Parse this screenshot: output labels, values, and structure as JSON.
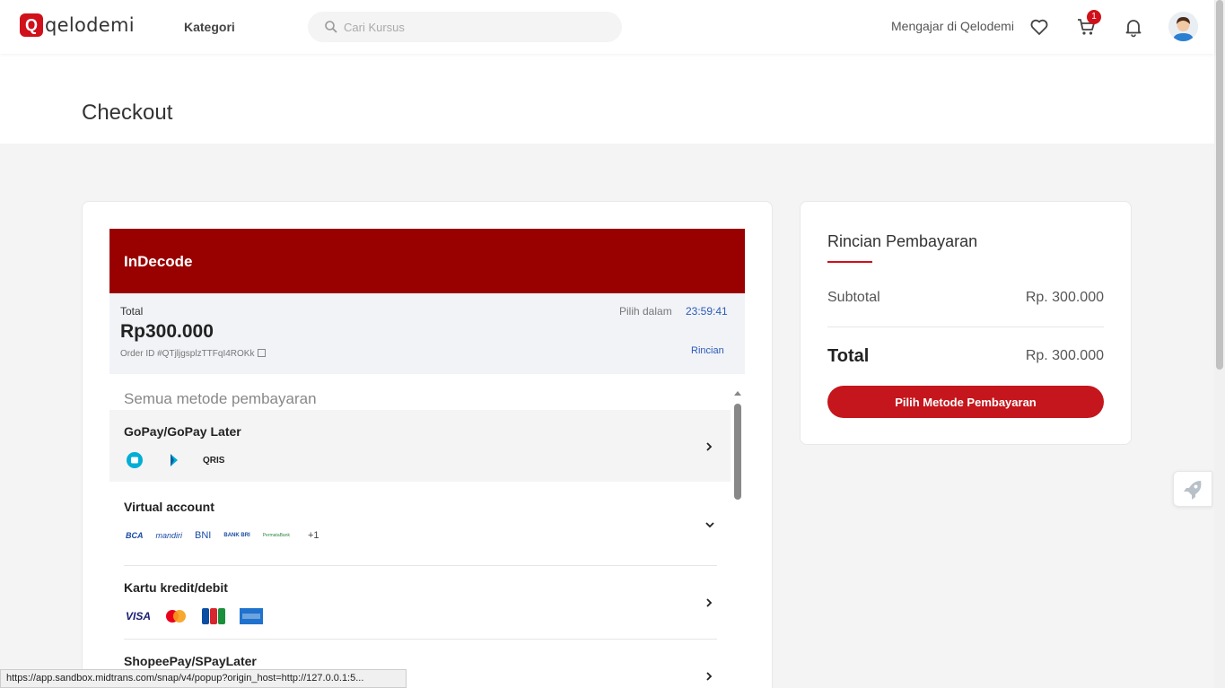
{
  "header": {
    "logo_mark": "Q",
    "logo_text": "qelodemi",
    "kategori": "Kategori",
    "search_placeholder": "Cari Kursus",
    "teach_link": "Mengajar di Qelodemi",
    "cart_count": "1"
  },
  "page": {
    "title": "Checkout"
  },
  "snap": {
    "merchant": "InDecode",
    "total_label": "Total",
    "total_amount": "Rp300.000",
    "order_id": "Order ID #QTjljgsplzTTFqI4ROKk",
    "timer_label": "Pilih dalam",
    "timer": "23:59:41",
    "details_link": "Rincian",
    "all_methods": "Semua metode pembayaran",
    "methods": [
      {
        "name": "GoPay/GoPay Later",
        "logos": [
          "gopay",
          "gopay-later",
          "QRIS"
        ]
      },
      {
        "name": "Virtual account",
        "logos": [
          "BCA",
          "mandiri",
          "BNI",
          "BANK BRI",
          "PermataBank",
          "+1"
        ]
      },
      {
        "name": "Kartu kredit/debit",
        "logos": [
          "VISA",
          "mastercard",
          "JCB",
          "AMEX"
        ]
      },
      {
        "name": "ShopeePay/SPayLater",
        "logos": []
      }
    ]
  },
  "summary": {
    "title": "Rincian Pembayaran",
    "subtotal_label": "Subtotal",
    "subtotal_value": "Rp. 300.000",
    "total_label": "Total",
    "total_value": "Rp. 300.000",
    "pay_button": "Pilih Metode Pembayaran"
  },
  "status_bar": "https://app.sandbox.midtrans.com/snap/v4/popup?origin_host=http://127.0.0.1:5...",
  "colors": {
    "brand_red": "#d0101a",
    "snap_header": "#990000",
    "link_blue": "#2c5ab7"
  }
}
